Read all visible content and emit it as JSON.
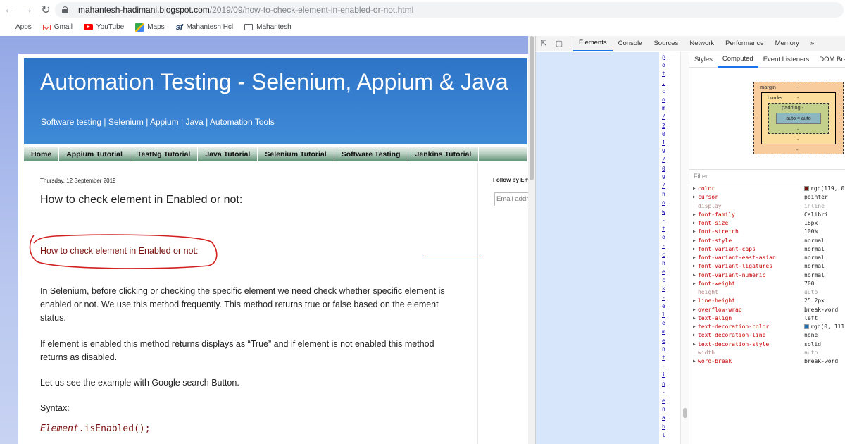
{
  "browser": {
    "url_host": "mahantesh-hadimani.blogspot.com",
    "url_path": "/2019/09/how-to-check-element-in-enabled-or-not.html",
    "bookmarks": [
      {
        "label": "Apps",
        "icon": "apps-grid-icon"
      },
      {
        "label": "Gmail",
        "icon": "gmail-icon"
      },
      {
        "label": "YouTube",
        "icon": "youtube-icon"
      },
      {
        "label": "Maps",
        "icon": "maps-icon"
      },
      {
        "label": "Mahantesh Hcl",
        "icon": "sf-icon"
      },
      {
        "label": "Mahantesh",
        "icon": "folder-icon"
      }
    ]
  },
  "blog": {
    "title": "Automation Testing - Selenium, Appium & Java",
    "description": "Software testing | Selenium | Appium | Java | Automation Tools",
    "tabs": [
      "Home",
      "Appium Tutorial",
      "TestNg Tutorial",
      "Java Tutorial",
      "Selenium Tutorial",
      "Software Testing",
      "Jenkins Tutorial"
    ],
    "post": {
      "date": "Thursday, 12 September 2019",
      "title": "How to check element in Enabled or not:",
      "subheading": "How to check element in Enabled or not:",
      "para1": "In Selenium, before clicking or checking the specific element we need check whether specific element is enabled or not. We use this method frequently. This method returns true or false based on the element status.",
      "para2": " If element is enabled this method returns displays as “True” and if element is not enabled this method returns as disabled.",
      "para3": "Let us see the example with Google search Button.",
      "para4": "Syntax:",
      "code_italic": "Element",
      "code_rest": ".isEnabled();"
    },
    "sidebar": {
      "follow_label": "Follow by Em",
      "email_placeholder": "Email addr"
    }
  },
  "devtools": {
    "tabs": [
      "Elements",
      "Console",
      "Sources",
      "Network",
      "Performance",
      "Memory"
    ],
    "more": "»",
    "active_tab": "Elements",
    "vertical_link_chars": [
      "p",
      "o",
      "t",
      ".",
      "c",
      "o",
      "m",
      "/",
      "2",
      "0",
      "1",
      "9",
      "/",
      "0",
      "9",
      "/",
      "h",
      "o",
      "w",
      "-",
      "t",
      "o",
      "-",
      "c",
      "h",
      "e",
      "c",
      "k",
      "-",
      "e",
      "l",
      "e",
      "m",
      "e",
      "n",
      "t",
      "-",
      "i",
      "n",
      "-",
      "e",
      "n",
      "a",
      "b",
      "l"
    ],
    "styles_tabs": [
      "Styles",
      "Computed",
      "Event Listeners",
      "DOM Bre"
    ],
    "active_styles_tab": "Computed",
    "box_model": {
      "margin_label": "margin",
      "border_label": "border",
      "padding_label": "padding -",
      "content": "auto × auto",
      "dash": "-"
    },
    "filter_placeholder": "Filter",
    "computed": [
      {
        "name": "color",
        "value": "rgb(119, 0",
        "swatch": "#771111",
        "expandable": true,
        "inherited": false
      },
      {
        "name": "cursor",
        "value": "pointer",
        "expandable": true,
        "inherited": false
      },
      {
        "name": "display",
        "value": "inline",
        "expandable": false,
        "inherited": true
      },
      {
        "name": "font-family",
        "value": "Calibri",
        "expandable": true,
        "inherited": false
      },
      {
        "name": "font-size",
        "value": "18px",
        "expandable": true,
        "inherited": false
      },
      {
        "name": "font-stretch",
        "value": "100%",
        "expandable": true,
        "inherited": false
      },
      {
        "name": "font-style",
        "value": "normal",
        "expandable": true,
        "inherited": false
      },
      {
        "name": "font-variant-caps",
        "value": "normal",
        "expandable": true,
        "inherited": false
      },
      {
        "name": "font-variant-east-asian",
        "value": "normal",
        "expandable": true,
        "inherited": false
      },
      {
        "name": "font-variant-ligatures",
        "value": "normal",
        "expandable": true,
        "inherited": false
      },
      {
        "name": "font-variant-numeric",
        "value": "normal",
        "expandable": true,
        "inherited": false
      },
      {
        "name": "font-weight",
        "value": "700",
        "expandable": true,
        "inherited": false
      },
      {
        "name": "height",
        "value": "auto",
        "expandable": false,
        "inherited": true
      },
      {
        "name": "line-height",
        "value": "25.2px",
        "expandable": true,
        "inherited": false
      },
      {
        "name": "overflow-wrap",
        "value": "break-word",
        "expandable": true,
        "inherited": false
      },
      {
        "name": "text-align",
        "value": "left",
        "expandable": true,
        "inherited": false
      },
      {
        "name": "text-decoration-color",
        "value": "rgb(0, 111",
        "swatch": "#1f6fb5",
        "expandable": true,
        "inherited": false
      },
      {
        "name": "text-decoration-line",
        "value": "none",
        "expandable": true,
        "inherited": false
      },
      {
        "name": "text-decoration-style",
        "value": "solid",
        "expandable": true,
        "inherited": false
      },
      {
        "name": "width",
        "value": "auto",
        "expandable": false,
        "inherited": true
      },
      {
        "name": "word-break",
        "value": "break-word",
        "expandable": true,
        "inherited": false
      }
    ]
  }
}
